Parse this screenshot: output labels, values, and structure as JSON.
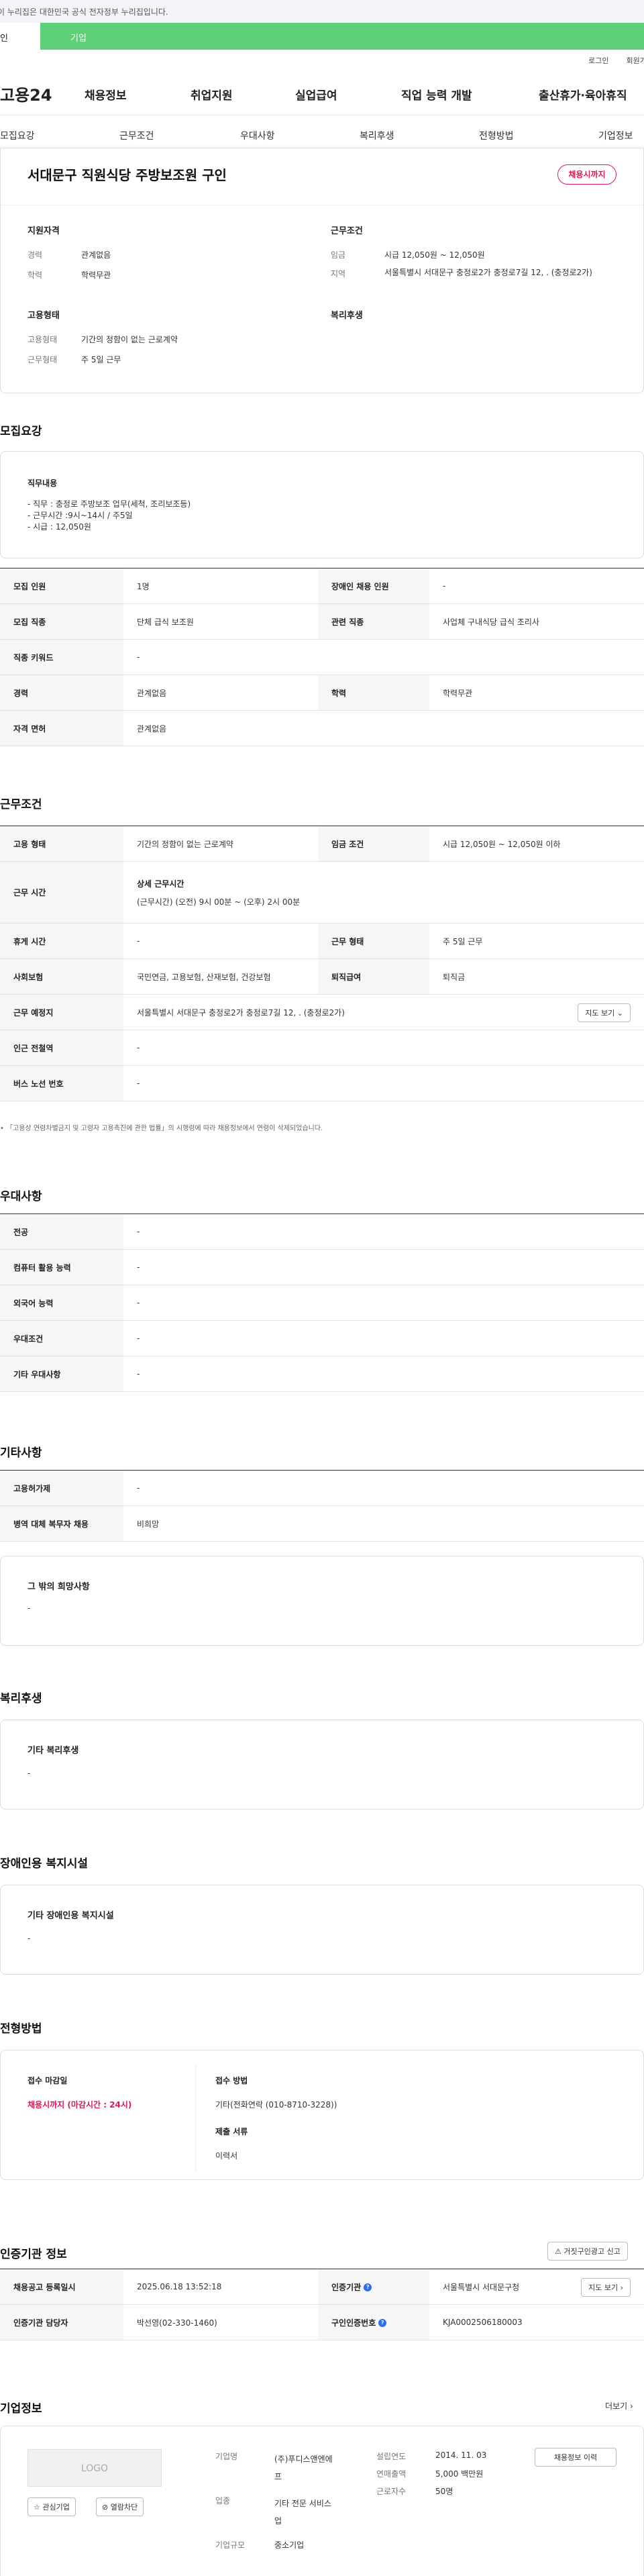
{
  "gov_notice": "이 누리집은 대한민국 공식 전자정부 누리집입니다.",
  "tabs": {
    "personal": "인",
    "corporate": "기업"
  },
  "util": {
    "login": "로그인",
    "join": "회원가입"
  },
  "gnb": {
    "logo": "고용24",
    "menu": [
      "채용정보",
      "취업지원",
      "실업급여",
      "직업 능력 개발",
      "출산휴가·육아휴직"
    ]
  },
  "anchor_tabs": [
    "모집요강",
    "근무조건",
    "우대사항",
    "복리후생",
    "전형방법",
    "기업정보"
  ],
  "job": {
    "title": "서대문구 직원식당 주방보조원 구인",
    "status_badge": "채용시까지",
    "qual_heading": "지원자격",
    "career_label": "경력",
    "career_value": "관계없음",
    "edu_label": "학력",
    "edu_value": "학력무관",
    "cond_heading": "근무조건",
    "wage_label": "임금",
    "wage_value": "시급 12,050원 ~ 12,050원",
    "region_label": "지역",
    "region_value": "서울특별시 서대문구 충정로2가 충정로7길 12, . (충정로2가)",
    "emp_heading": "고용형태",
    "emp_type_label": "고용형태",
    "emp_type_value": "기간의 정함이 없는 근로계약",
    "work_type_label": "근무형태",
    "work_type_value": "주 5일 근무",
    "welfare_heading": "복리후생"
  },
  "recruit": {
    "title": "모집요강",
    "duty_heading": "직무내용",
    "duty_lines": [
      "- 직무 : 충정로 주방보조 업무(세척, 조리보조등)",
      "- 근무시간 :9시~14시 / 주5일",
      "- 시급 : 12,050원"
    ],
    "rows": [
      {
        "k1": "모집 인원",
        "v1": "1명",
        "k2": "장애인 채용 인원",
        "v2": "-"
      },
      {
        "k1": "모집 직종",
        "v1": "단체 급식 보조원",
        "k2": "관련 직종",
        "v2": "사업체 구내식당 급식 조리사"
      },
      {
        "k1": "직종 키워드",
        "v1": "-"
      },
      {
        "k1": "경력",
        "v1": "관계없음",
        "k2": "학력",
        "v2": "학력무관"
      },
      {
        "k1": "자격 면허",
        "v1": "관계없음"
      }
    ]
  },
  "conditions": {
    "title": "근무조건",
    "emp_k": "고용 형태",
    "emp_v": "기간의 정함이 없는 근로계약",
    "wage_k": "임금 조건",
    "wage_v": "시급 12,050원 ~ 12,050원 이하",
    "hours_k": "근무 시간",
    "hours_head": "상세 근무시간",
    "hours_v": "(근무시간) (오전) 9시 00분 ~ (오후) 2시 00분",
    "break_k": "휴게 시간",
    "break_v": "-",
    "form_k": "근무 형태",
    "form_v": "주 5일 근무",
    "ins_k": "사회보험",
    "ins_v": "국민연금, 고용보험, 산재보험, 건강보험",
    "sev_k": "퇴직급여",
    "sev_v": "퇴직금",
    "place_k": "근무 예정지",
    "place_v": "서울특별시 서대문구 충정로2가 충정로7길 12, . (충정로2가)",
    "map_btn": "지도 보기",
    "station_k": "인근 전철역",
    "station_v": "-",
    "bus_k": "버스 노선 번호",
    "bus_v": "-",
    "note": "「고용상 연령차별금지 및 고령자 고용촉진에 관한 법률」의 시행령에 따라 채용정보에서 연령이 삭제되었습니다."
  },
  "preferences": {
    "title": "우대사항",
    "rows": [
      {
        "k": "전공",
        "v": "-"
      },
      {
        "k": "컴퓨터 활용 능력",
        "v": "-"
      },
      {
        "k": "외국어 능력",
        "v": "-"
      },
      {
        "k": "우대조건",
        "v": "-"
      },
      {
        "k": "기타 우대사항",
        "v": "-"
      }
    ]
  },
  "others": {
    "title": "기타사항",
    "rows": [
      {
        "k": "고용허가제",
        "v": "-"
      },
      {
        "k": "병역 대체 복무자 채용",
        "v": "비희망"
      }
    ],
    "misc_heading": "그 밖의 희망사항",
    "misc_value": "-"
  },
  "welfare": {
    "title": "복리후생",
    "heading": "기타 복리후생",
    "value": "-"
  },
  "disability": {
    "title": "장애인용 복지시설",
    "heading": "기타 장애인용 복지시설",
    "value": "-"
  },
  "selection": {
    "title": "전형방법",
    "deadline_head": "접수 마감일",
    "deadline_value": "채용시까지 (마감시간 : 24시)",
    "method_head": "접수 방법",
    "method_value": "기타(전화연락 (010-8710-3228))",
    "docs_head": "제출 서류",
    "docs_value": "이력서"
  },
  "agency": {
    "title": "인증기관 정보",
    "report_btn": "거짓구인광고 신고",
    "reg_k": "채용공고 등록일시",
    "reg_v": "2025.06.18 13:52:18",
    "org_k": "인증기관",
    "org_v": "서울특별시 서대문구청",
    "map_btn": "지도 보기",
    "manager_k": "인증기관 담당자",
    "manager_v": "박선영(02-330-1460)",
    "id_k": "구인인증번호",
    "id_v": "KJA0002506180003"
  },
  "company": {
    "title": "기업정보",
    "more": "더보기",
    "logo_text": "LOGO",
    "fav_btn": "관심기업",
    "block_btn": "열람차단",
    "name_k": "기업명",
    "name_v1": "(주)푸디스앤엔에",
    "name_v2": "프",
    "ind_k": "업종",
    "ind_v1": "기타 전문 서비스",
    "ind_v2": "업",
    "size_k": "기업규모",
    "size_v": "중소기업",
    "year_k": "설립연도",
    "year_v": "2014. 11. 03",
    "sales_k": "연매출액",
    "sales_v": "5,000 백만원",
    "staff_k": "근로자수",
    "staff_v": "50명",
    "history_btn": "채용정보 이력"
  }
}
